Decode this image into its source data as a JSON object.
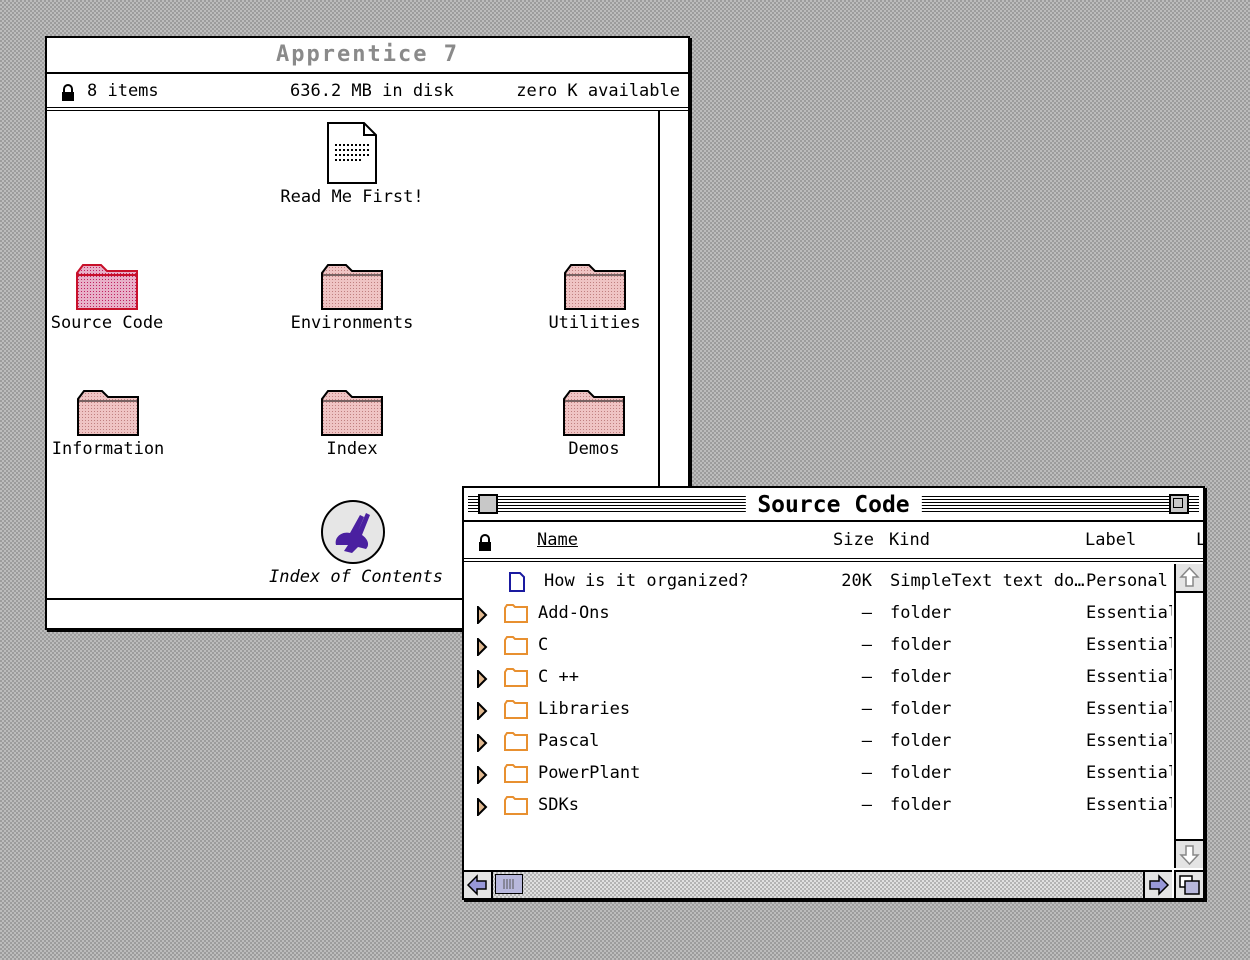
{
  "apprentice_window": {
    "title": "Apprentice 7",
    "items_count": "8 items",
    "disk_usage": "636.2 MB in disk",
    "available": "zero K available",
    "icons": [
      {
        "label": "Read Me First!",
        "icon": "document-icon"
      },
      {
        "label": "Source Code",
        "icon": "folder-icon"
      },
      {
        "label": "Environments",
        "icon": "folder-icon"
      },
      {
        "label": "Utilities",
        "icon": "folder-icon"
      },
      {
        "label": "Information",
        "icon": "folder-icon"
      },
      {
        "label": "Index",
        "icon": "folder-icon"
      },
      {
        "label": "Demos",
        "icon": "folder-icon"
      },
      {
        "label": "Index of Contents",
        "icon": "rabbit-app-icon"
      }
    ]
  },
  "source_code_window": {
    "title": "Source Code",
    "columns": {
      "name": "Name",
      "size": "Size",
      "kind": "Kind",
      "label": "Label",
      "label_extra": "L"
    },
    "rows": [
      {
        "name": "How is it organized?",
        "size": "20K",
        "kind": "SimpleText text do…",
        "label": "Personal",
        "type": "document"
      },
      {
        "name": "Add-Ons",
        "size": "—",
        "kind": "folder",
        "label": "Essential",
        "type": "folder"
      },
      {
        "name": "C",
        "size": "—",
        "kind": "folder",
        "label": "Essential",
        "type": "folder"
      },
      {
        "name": "C ++",
        "size": "—",
        "kind": "folder",
        "label": "Essential",
        "type": "folder"
      },
      {
        "name": "Libraries",
        "size": "—",
        "kind": "folder",
        "label": "Essential",
        "type": "folder"
      },
      {
        "name": "Pascal",
        "size": "—",
        "kind": "folder",
        "label": "Essential",
        "type": "folder"
      },
      {
        "name": "PowerPlant",
        "size": "—",
        "kind": "folder",
        "label": "Essential",
        "type": "folder"
      },
      {
        "name": "SDKs",
        "size": "—",
        "kind": "folder",
        "label": "Essential",
        "type": "folder"
      }
    ]
  },
  "colors": {
    "folder_pink": "#e8b8b8",
    "folder_selected": "#d0406a",
    "folder_outline_small": "#e89030",
    "rabbit_purple": "#4a20a0",
    "doc_blue": "#1a1aa0"
  }
}
